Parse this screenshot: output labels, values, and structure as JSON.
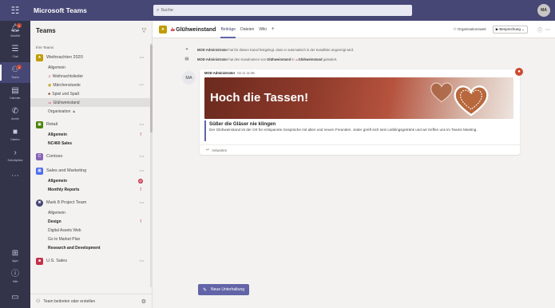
{
  "topbar": {
    "app_title": "Microsoft Teams",
    "search_placeholder": "Suche",
    "avatar_initials": "MA"
  },
  "rail": {
    "items": [
      {
        "label": "Aktivität",
        "icon": "bell-icon",
        "badge": "1"
      },
      {
        "label": "Chat",
        "icon": "chat-icon"
      },
      {
        "label": "Teams",
        "icon": "teams-icon",
        "badge": "1"
      },
      {
        "label": "Kalender",
        "icon": "calendar-icon"
      },
      {
        "label": "Anrufe",
        "icon": "phone-icon"
      },
      {
        "label": "Dateien",
        "icon": "files-icon"
      },
      {
        "label": "Schichtpläne",
        "icon": "chevron-right-icon"
      }
    ],
    "bottom": [
      {
        "label": "Apps",
        "icon": "apps-icon"
      },
      {
        "label": "Hilfe",
        "icon": "help-icon"
      }
    ]
  },
  "panel": {
    "title": "Teams",
    "section_label": "Ihre Teams",
    "teams": [
      {
        "name": "Weihnachten 2020",
        "color": "#c19c00",
        "channels": [
          {
            "name": "Allgemein"
          },
          {
            "name": "Weihnachtslieder"
          },
          {
            "name": "Märchenstunde"
          },
          {
            "name": "Spiel und Spaß"
          },
          {
            "name": "Glühweinstand"
          },
          {
            "name": "Organisation"
          }
        ]
      },
      {
        "name": "Retail",
        "color": "#498205",
        "channels": [
          {
            "name": "Allgemein",
            "alert": "!"
          },
          {
            "name": "NC460 Sales"
          }
        ]
      },
      {
        "name": "Contoso",
        "color": "#8764b8",
        "channels": []
      },
      {
        "name": "Sales and Marketing",
        "color": "#4f6bed",
        "channels": [
          {
            "name": "Allgemein",
            "mention": "@"
          },
          {
            "name": "Monthly Reports",
            "alert": "!"
          }
        ]
      },
      {
        "name": "Mark 8 Project Team",
        "color": "#464775",
        "channels": [
          {
            "name": "Allgemein"
          },
          {
            "name": "Design",
            "alert": "!"
          },
          {
            "name": "Digital Assets Web"
          },
          {
            "name": "Go to Market Plan"
          },
          {
            "name": "Research and Development"
          }
        ]
      },
      {
        "name": "U.S. Sales",
        "color": "#c4314b",
        "channels": []
      }
    ],
    "footer": "Team beitreten oder erstellen"
  },
  "main": {
    "channel_name": "Glühweinstand",
    "tabs": [
      "Beiträge",
      "Dateien",
      "Wiki"
    ],
    "org_label": "Organisationsweit",
    "meet_label": "Besprechung",
    "system_messages": [
      {
        "icon": "pin-icon",
        "actor": "MOD Administrator",
        "text": "hat für diesen Kanal festgelegt, dass er automatisch in der Kanalliste angezeigt wird."
      },
      {
        "icon": "rename-icon",
        "actor": "MOD Administrator",
        "text_a": "hat den Kanalnamen von",
        "old": "Glühweinstand",
        "text_b": "in",
        "new": "Glühweinstand",
        "text_c": "geändert."
      }
    ],
    "post": {
      "avatar": "MA",
      "author": "MOD Administrator",
      "time": "02.11 11:06",
      "hero_title": "Hoch die Tassen!",
      "headline": "Süßer die Gläser nie klingen",
      "body": "Der Glühweinstand ist der Ort für entspannte Gespräche mit alten und neuen Freunden. Jeder greift sich sein Lieblingsgetränk und wir treffen uns im Teams Meeting.",
      "reply_label": "Antworten"
    },
    "new_conversation_label": "Neue Unterhaltung"
  }
}
